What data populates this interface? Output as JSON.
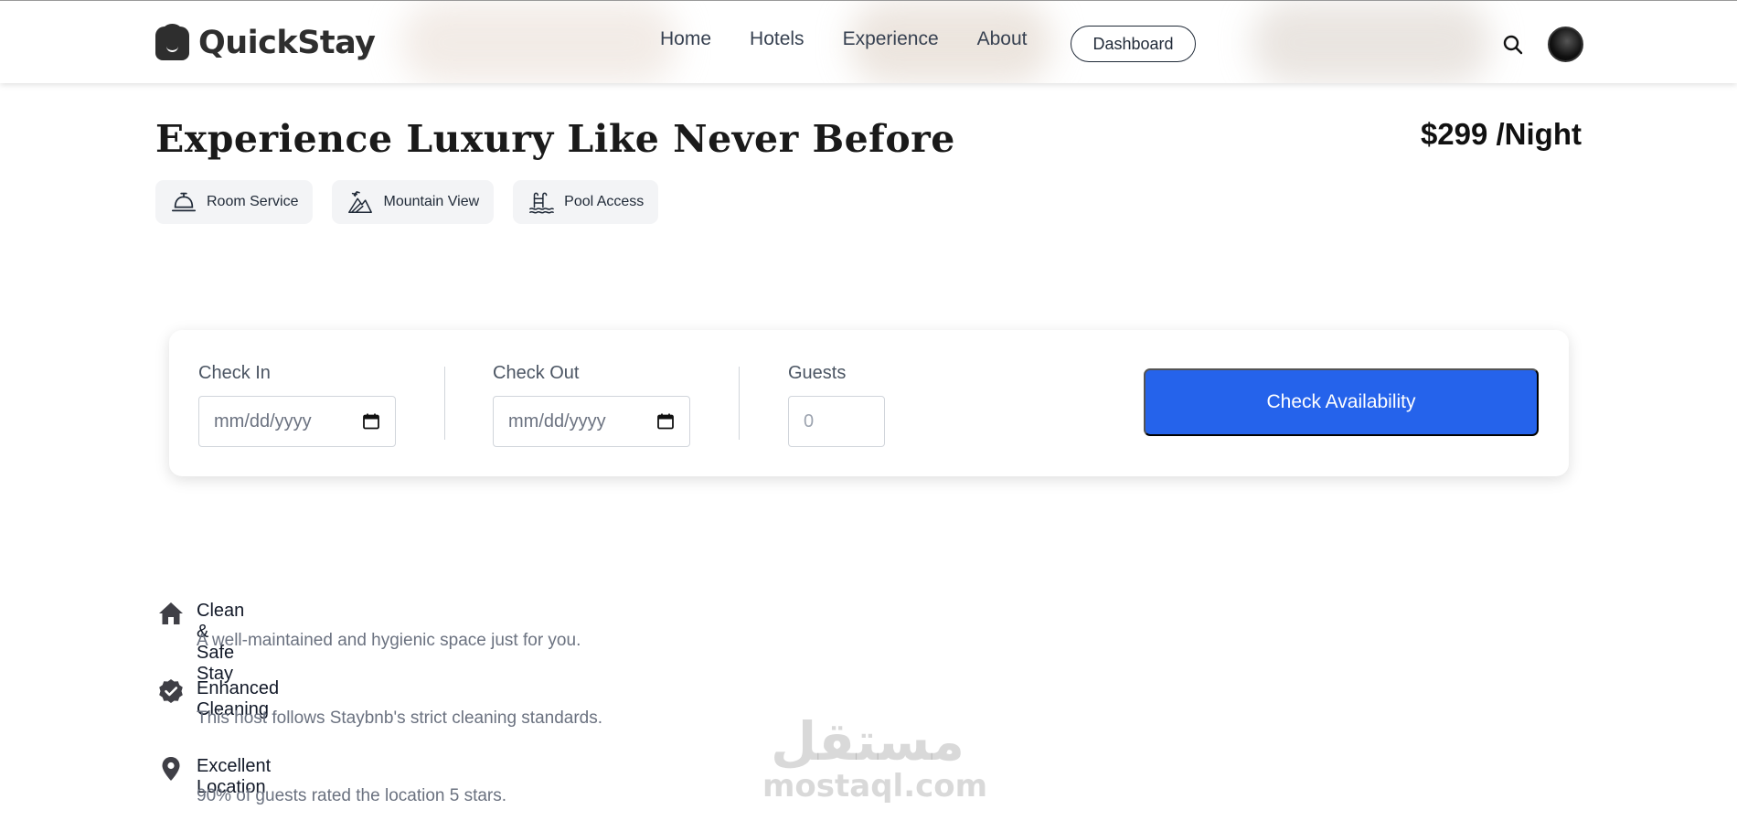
{
  "nav": {
    "brand": "QuickStay",
    "links": [
      "Home",
      "Hotels",
      "Experience",
      "About"
    ],
    "dashboard_label": "Dashboard",
    "search_icon": "search-icon",
    "avatar_icon": "user-avatar"
  },
  "room": {
    "title": "Experience Luxury Like Never Before",
    "price": "$299 /Night",
    "amenities": [
      {
        "label": "Room Service",
        "icon": "bell-icon"
      },
      {
        "label": "Mountain View",
        "icon": "mountain-icon"
      },
      {
        "label": "Pool Access",
        "icon": "pool-icon"
      }
    ]
  },
  "booking": {
    "checkin_label": "Check In",
    "checkin_placeholder": "mm/dd/yyyy",
    "checkout_label": "Check Out",
    "checkout_placeholder": "mm/dd/yyyy",
    "guests_label": "Guests",
    "guests_placeholder": "0",
    "submit_label": "Check Availability"
  },
  "features": [
    {
      "title": "Clean & Safe Stay",
      "desc": "A well-maintained and hygienic space just for you.",
      "icon": "home-icon"
    },
    {
      "title": "Enhanced Cleaning",
      "desc": "This host follows Staybnb's strict cleaning standards.",
      "icon": "badge-check-icon"
    },
    {
      "title": "Excellent Location",
      "desc": "90% of guests rated the location 5 stars.",
      "icon": "location-pin-icon"
    }
  ],
  "watermark": {
    "arabic": "مستقل",
    "latin": "mostaql.com"
  },
  "colors": {
    "accent": "#2563eb",
    "text": "#1f2937",
    "muted": "#6b7280",
    "chip_bg": "#f3f4f6"
  }
}
